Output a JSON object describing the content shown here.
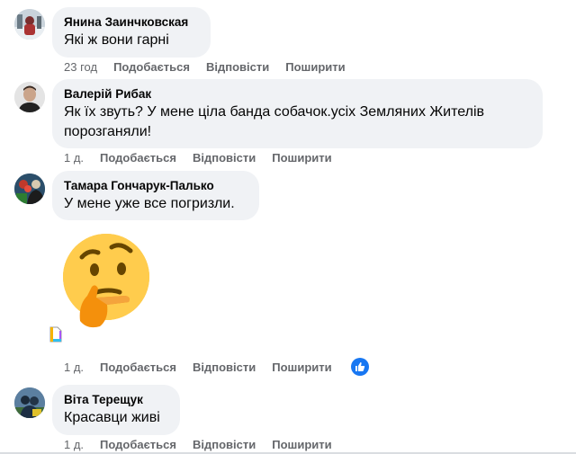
{
  "comments": [
    {
      "author": "Янина Заинчковская",
      "text": "Які ж вони гарні",
      "time": "23 год",
      "like": "Подобається",
      "reply": "Відповісти",
      "share": "Поширити"
    },
    {
      "author": "Валерій Рибак",
      "text": "Як їх звуть? У мене ціла банда собачок.усіх Земляних Жителів порозганяли!",
      "time": "1 д.",
      "like": "Подобається",
      "reply": "Відповісти",
      "share": "Поширити"
    },
    {
      "author": "Тамара Гончарук-Палько",
      "text": "У мене уже все погризли.",
      "time": "1 д.",
      "like": "Подобається",
      "reply": "Відповісти",
      "share": "Поширити",
      "emoji": "thinking-face"
    },
    {
      "author": "Віта Терещук",
      "text": "Красавци живі",
      "time": "1 д.",
      "like": "Подобається",
      "reply": "Відповісти",
      "share": "Поширити"
    }
  ],
  "icons": {
    "like_badge": "thumbs-up-icon",
    "sticker_attachment": "file-icon"
  },
  "colors": {
    "bubble_bg": "#f0f2f5",
    "meta_text": "#65676b",
    "like_blue": "#1877f2"
  }
}
